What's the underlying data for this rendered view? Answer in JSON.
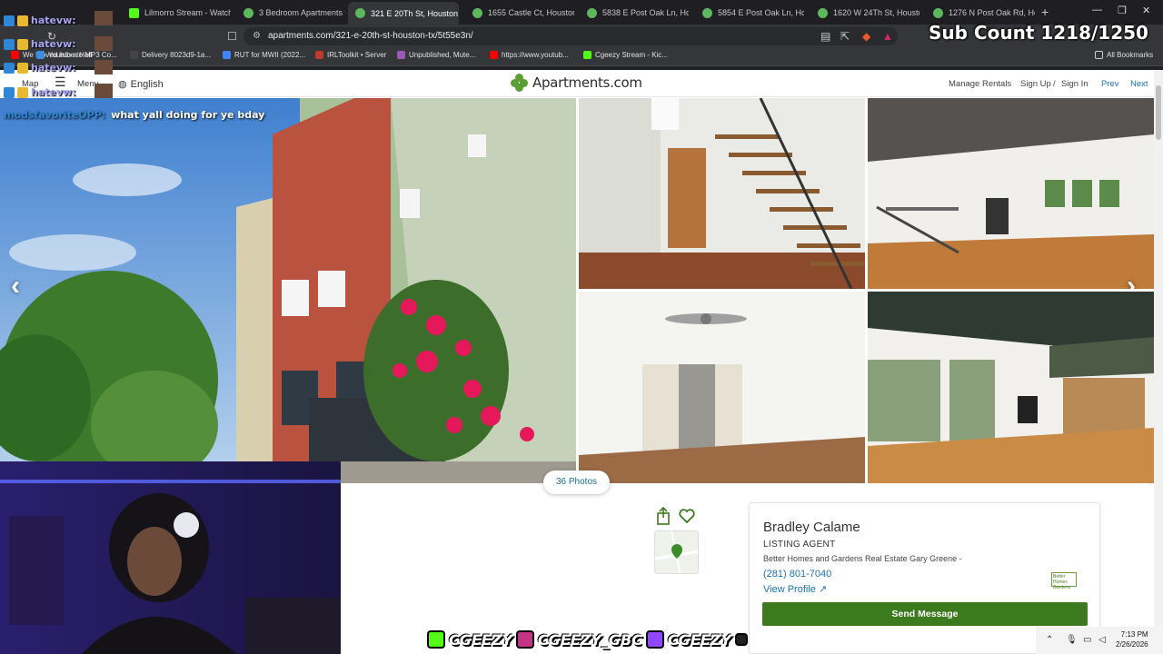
{
  "browser": {
    "tabs": [
      {
        "label": "Lilmorro Stream - Watch L",
        "icon": "kick-icon"
      },
      {
        "label": "3 Bedroom Apartments fo",
        "icon": "apartments-icon"
      },
      {
        "label": "321 E 20Th St, Houston",
        "icon": "apartments-icon"
      },
      {
        "label": "1655 Castle Ct, Houston, T",
        "icon": "apartments-icon"
      },
      {
        "label": "5838 E Post Oak Ln, Houst",
        "icon": "apartments-icon"
      },
      {
        "label": "5854 E Post Oak Ln, Houst",
        "icon": "apartments-icon"
      },
      {
        "label": "1620 W 24Th St, Houston",
        "icon": "apartments-icon"
      },
      {
        "label": "1276 N Post Oak Rd, Hou",
        "icon": "apartments-icon"
      }
    ],
    "new_tab": "+",
    "url": "apartments.com/321-e-20th-st-houston-tx/5t55e3n/",
    "bookmarks": [
      "We Moved into a Half",
      "Youtube to MP3 Co...",
      "Delivery 8023d9-1a...",
      "RUT for MWII (2022...",
      "IRLToolkit • Server",
      "Unpublished, Mute...",
      "https://www.youtub...",
      "Cgeezy Stream - Kic..."
    ],
    "all_bookmarks": "All Bookmarks"
  },
  "nav": {
    "menu": "Menu",
    "map": "Map",
    "language": "English",
    "brand": "Apartments.com",
    "links": [
      "Manage Rentals",
      "Sign Up",
      "/",
      "Sign In"
    ],
    "prev": "Prev",
    "next": "Next"
  },
  "gallery": {
    "photo_count": "36 Photos"
  },
  "agent": {
    "name": "Bradley Calame",
    "role": "LISTING AGENT",
    "company": "Better Homes and Gardens Real Estate Gary Greene -",
    "phone": "(281) 801-7040",
    "profile": "View Profile",
    "send": "Send Message",
    "logo_text": "Better Homes Gardens"
  },
  "stream": {
    "chat_user": "hatevw:",
    "chat_user_partial": "hatevw:",
    "message_user": "modsfavoriteOPP:",
    "message_text": "what yall doing for ye bday",
    "sub_count": "Sub Count 1218/1250",
    "socials": [
      "CGEEZY",
      "CGEEZY_GBC",
      "CGEEZY"
    ]
  },
  "taskbar": {
    "time": "7:13 PM",
    "date": "2/26/2026"
  },
  "colors": {
    "accent_green": "#3c7a1e",
    "link_blue": "#1a73b5",
    "kick_green": "#53fc18"
  }
}
